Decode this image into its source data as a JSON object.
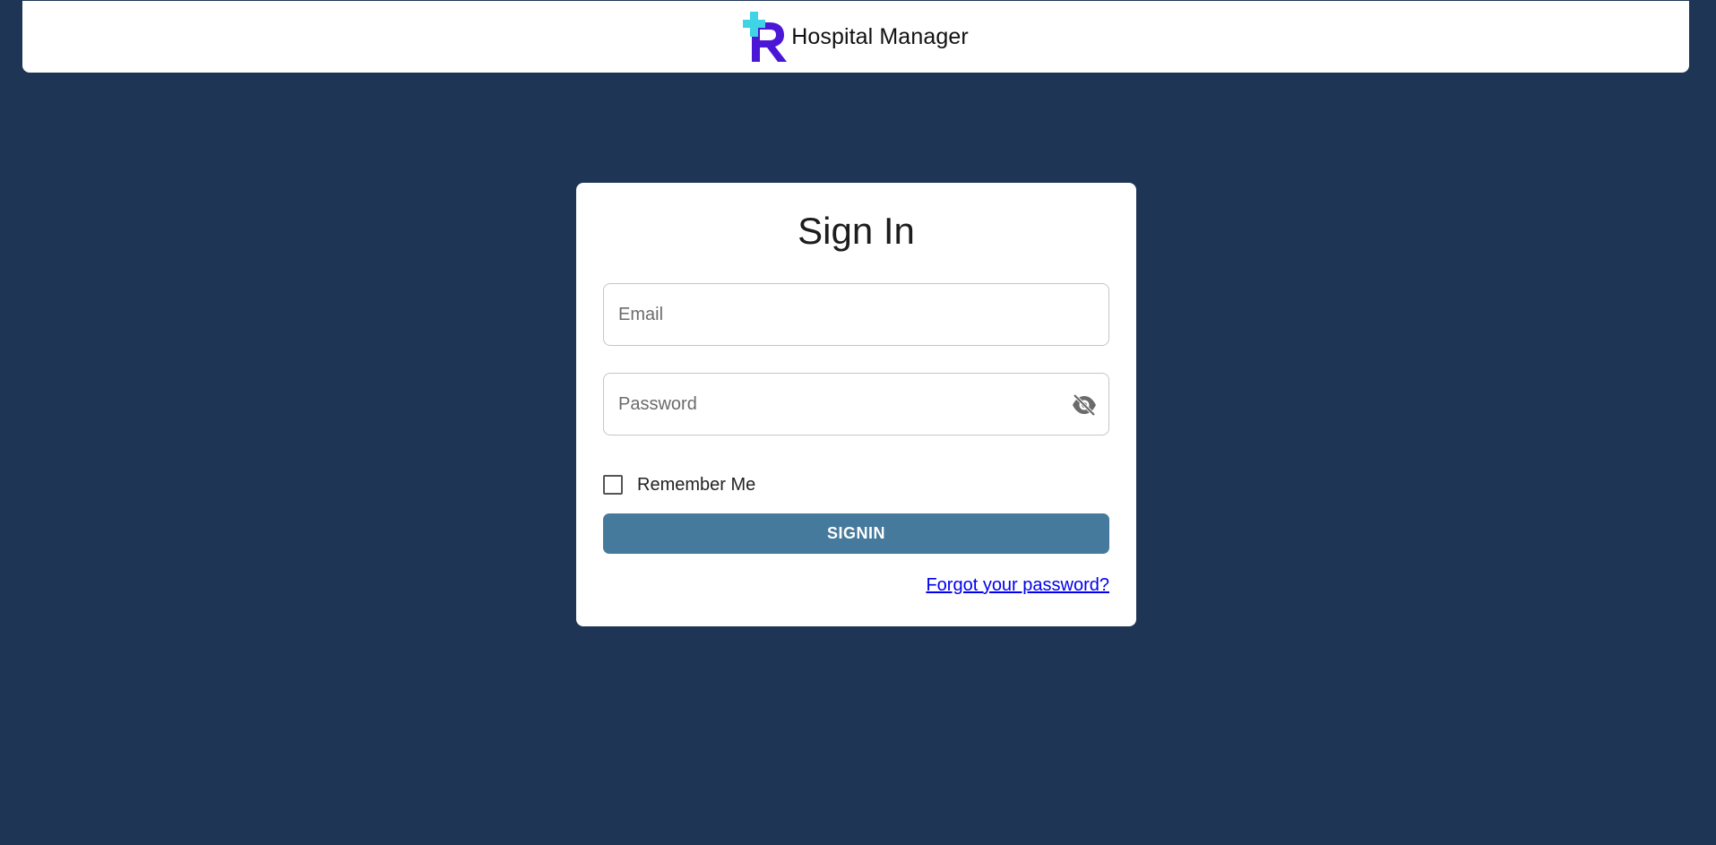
{
  "header": {
    "app_name": "Hospital Manager",
    "logo_icon": "hospital-cross-r-logo",
    "logo_colors": {
      "cross": "#3fd3e6",
      "letter": "#4a17d6"
    }
  },
  "signin": {
    "title": "Sign In",
    "email_placeholder": "Email",
    "email_value": "",
    "password_placeholder": "Password",
    "password_value": "",
    "password_toggle_icon": "eye-off-icon",
    "remember_label": "Remember Me",
    "remember_checked": false,
    "submit_label": "SIGNIN",
    "forgot_label": "Forgot your password?"
  },
  "colors": {
    "background": "#1f3556",
    "card": "#ffffff",
    "button": "#467a9c",
    "link": "#0000ee"
  }
}
